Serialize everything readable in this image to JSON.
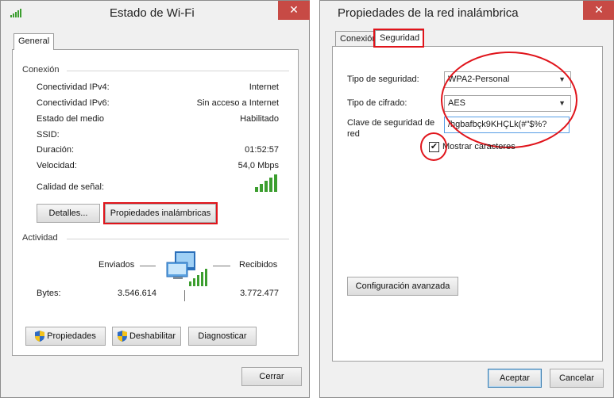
{
  "wifi_status": {
    "title": "Estado de Wi-Fi",
    "close_label": "✕",
    "tab_general": "General",
    "connection_header": "Conexión",
    "rows": [
      {
        "label": "Conectividad IPv4:",
        "value": "Internet"
      },
      {
        "label": "Conectividad IPv6:",
        "value": "Sin acceso a Internet"
      },
      {
        "label": "Estado del medio",
        "value": "Habilitado"
      },
      {
        "label": "SSID:",
        "value": ""
      },
      {
        "label": "Duración:",
        "value": "01:52:57"
      },
      {
        "label": "Velocidad:",
        "value": "54,0 Mbps"
      }
    ],
    "signal_quality_label": "Calidad de señal:",
    "details_button": "Detalles...",
    "wireless_properties_button": "Propiedades inalámbricas",
    "activity_header": "Actividad",
    "sent_label": "Enviados",
    "received_label": "Recibidos",
    "bytes_label": "Bytes:",
    "bytes_sent": "3.546.614",
    "bytes_received": "3.772.477",
    "properties_button": "Propiedades",
    "disable_button": "Deshabilitar",
    "diagnose_button": "Diagnosticar",
    "close_button": "Cerrar"
  },
  "wireless_properties": {
    "title": "Propiedades de la red inalámbrica",
    "close_label": "✕",
    "tab_connection": "Conexión",
    "tab_security": "Seguridad",
    "security_type_label": "Tipo de seguridad:",
    "security_type_value": "WPA2-Personal",
    "encryption_type_label": "Tipo de cifrado:",
    "encryption_type_value": "AES",
    "network_key_label_line1": "Clave de seguridad de",
    "network_key_label_line2": "red",
    "network_key_value": "/hgbafbçk9KHÇLk(#\"$%?",
    "show_characters_label": "Mostrar caracteres",
    "show_characters_checked": true,
    "advanced_button": "Configuración avanzada",
    "accept_button": "Aceptar",
    "cancel_button": "Cancelar"
  },
  "colors": {
    "annotation_red": "#e0141b",
    "close_red": "#c74a45",
    "signal_green": "#3c9e2f"
  },
  "icons": [
    "wifi-signal-icon",
    "network-computer-icon",
    "shield-icon",
    "close-icon",
    "chevron-down-icon",
    "checkmark-icon"
  ]
}
